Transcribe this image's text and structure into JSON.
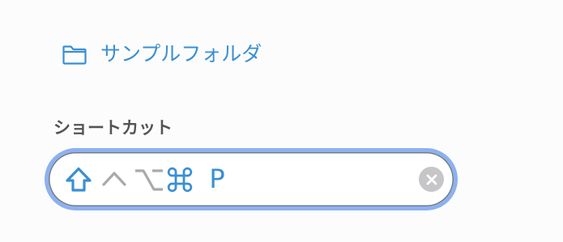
{
  "folder": {
    "label": "サンプルフォルダ",
    "icon": "folder-icon"
  },
  "shortcut": {
    "section_label": "ショートカット",
    "keys": [
      {
        "name": "shift",
        "icon": "shift-icon",
        "active": true
      },
      {
        "name": "control",
        "icon": "control-icon",
        "active": false
      },
      {
        "name": "option",
        "icon": "option-icon",
        "active": false
      },
      {
        "name": "command",
        "icon": "command-icon",
        "active": true
      }
    ],
    "key_letter": "P",
    "clear_icon": "clear-icon"
  },
  "colors": {
    "accent": "#3a8fd1",
    "inactive_key": "#a9a9ab",
    "focus_ring": "#8cb1ef",
    "label": "#545456",
    "clear_button": "#c6c6c8"
  }
}
